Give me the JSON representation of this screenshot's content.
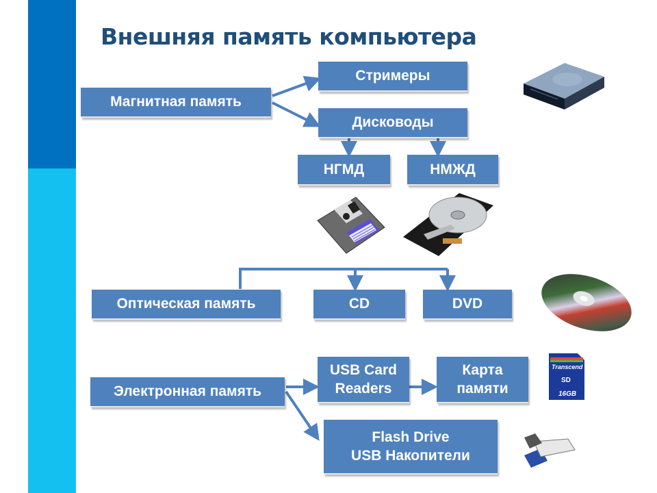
{
  "slide": {
    "title": "Внешняя память компьютера",
    "accent_colors": {
      "bar_top": "#0070c0",
      "bar_bottom": "#13c0f0",
      "box_fill": "#4f81bd",
      "title": "#1f4e79"
    }
  },
  "magnetic": {
    "root": "Магнитная память",
    "streamers": "Стримеры",
    "drives": "Дисководы",
    "fdd": "НГМД",
    "hdd": "НМЖД"
  },
  "optical": {
    "root": "Оптическая память",
    "cd": "CD",
    "dvd": "DVD"
  },
  "electronic": {
    "root": "Электронная память",
    "card_reader_line1": "USB Card",
    "card_reader_line2": "Readers",
    "memory_card_line1": "Карта",
    "memory_card_line2": "памяти",
    "flash_line1": "Flash Drive",
    "flash_line2": "USB Накопители"
  },
  "images": {
    "optical_drive": "optical-drive-icon",
    "floppy": "floppy-disk-icon",
    "hard_disk": "hard-disk-icon",
    "disc": "optical-disc-icon",
    "sd_card": "sd-card-icon",
    "sd_brand": "Transcend",
    "sd_capacity": "16GB",
    "usb_flash": "usb-flash-icon"
  }
}
